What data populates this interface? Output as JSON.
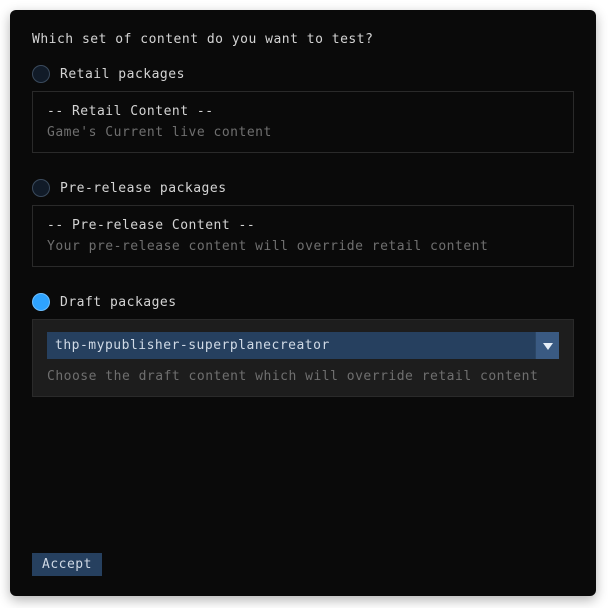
{
  "prompt": "Which set of content do you want to test?",
  "options": {
    "retail": {
      "label": "Retail packages",
      "title": "-- Retail Content --",
      "desc": "Game's Current live content"
    },
    "prerelease": {
      "label": "Pre-release packages",
      "title": "-- Pre-release Content --",
      "desc": "Your pre-release content will override retail content"
    },
    "draft": {
      "label": "Draft packages",
      "dropdown_value": "thp-mypublisher-superplanecreator",
      "desc": "Choose the draft content which will override retail content"
    }
  },
  "accept_label": "Accept"
}
